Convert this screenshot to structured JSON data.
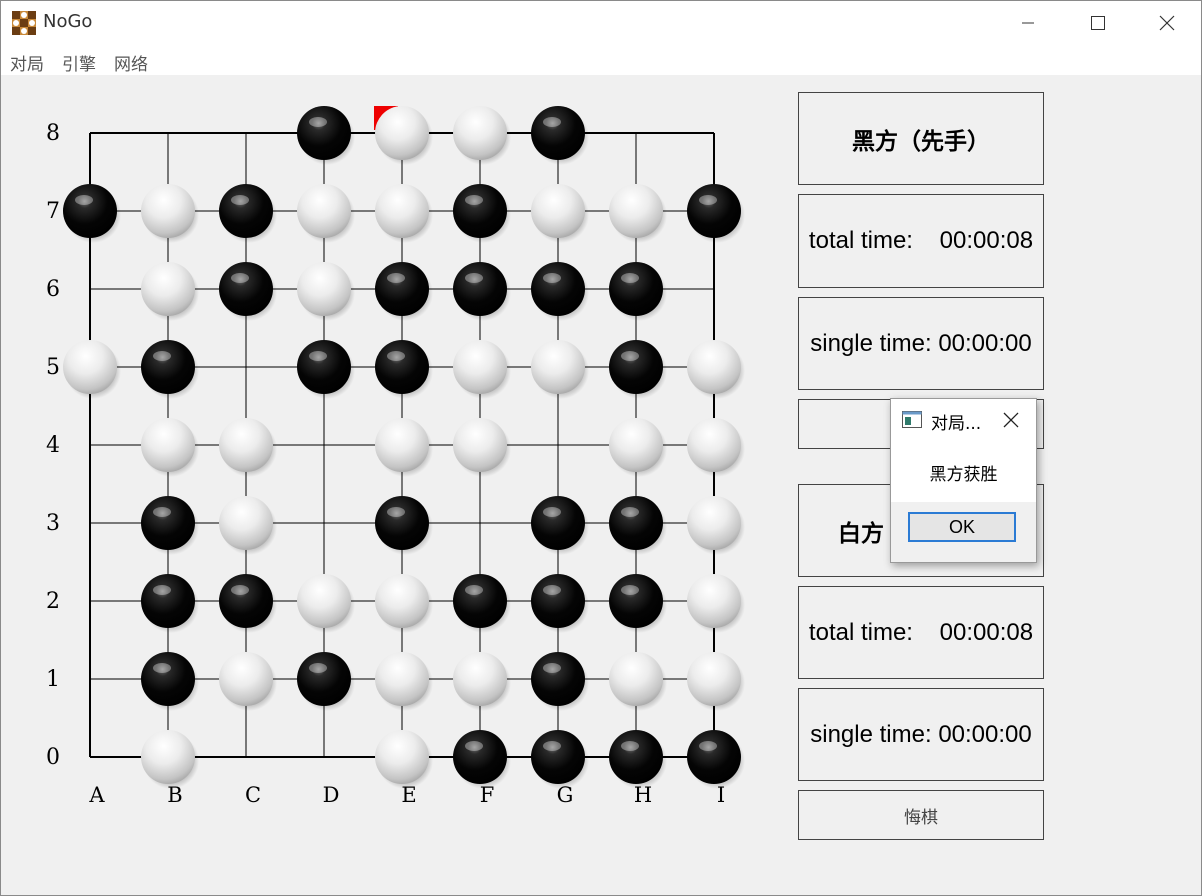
{
  "window": {
    "title": "NoGo",
    "app_icon": "board-game-icon",
    "controls": [
      "minimize-icon",
      "maximize-icon",
      "close-icon"
    ]
  },
  "menu": {
    "items": [
      "对局",
      "引擎",
      "网络"
    ]
  },
  "board": {
    "columns": [
      "A",
      "B",
      "C",
      "D",
      "E",
      "F",
      "G",
      "H",
      "I"
    ],
    "rows": [
      "8",
      "7",
      "6",
      "5",
      "4",
      "3",
      "2",
      "1",
      "0"
    ],
    "stones": [
      "...BWWB..",
      "BWBWWBWWB",
      ".WBWBBBB.",
      "WB.BBWWBW",
      ".WW.WW.WW",
      ".BW.B.BBW",
      ".BBWWBBBW",
      ".BWBWWBWW",
      ".W..WBBBB"
    ],
    "last_move": "E8",
    "colors": {
      "grid": "#000000",
      "last_move_marker": "#ee0000"
    }
  },
  "black_panel": {
    "title": "黑方（先手）",
    "total_label": "total time:",
    "total_value": "00:00:08",
    "single_label": "single time:",
    "single_value": "00:00:00"
  },
  "white_panel": {
    "title": "白方",
    "total_label": "total time:",
    "total_value": "00:00:08",
    "single_label": "single time:",
    "single_value": "00:00:00"
  },
  "undo_button": "悔棋",
  "dialog": {
    "title": "对局...",
    "message": "黑方获胜",
    "ok_label": "OK",
    "accent": "#2b7bd4"
  }
}
